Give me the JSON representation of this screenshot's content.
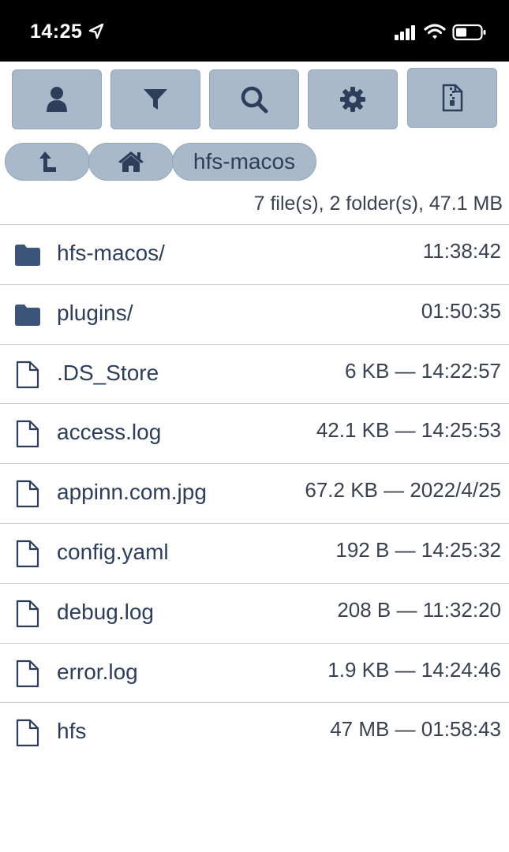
{
  "status_bar": {
    "time": "14:25"
  },
  "toolbar": {
    "buttons": [
      {
        "icon": "user-icon"
      },
      {
        "icon": "filter-icon"
      },
      {
        "icon": "search-icon"
      },
      {
        "icon": "gear-icon"
      },
      {
        "icon": "zip-archive-icon"
      }
    ]
  },
  "breadcrumb": {
    "up_icon": "up-arrow-icon",
    "home_icon": "home-icon",
    "current": "hfs-macos"
  },
  "summary": "7 file(s), 2 folder(s), 47.1 MB",
  "colors": {
    "button_bg": "#a9b9c9",
    "folder_icon": "#3b5478",
    "text": "#2c3e5a"
  },
  "entries": [
    {
      "type": "folder",
      "name": "hfs-macos/",
      "meta": "11:38:42"
    },
    {
      "type": "folder",
      "name": "plugins/",
      "meta": "01:50:35"
    },
    {
      "type": "file",
      "name": ".DS_Store",
      "meta": "6 KB — 14:22:57"
    },
    {
      "type": "file",
      "name": "access.log",
      "meta": "42.1 KB — 14:25:53"
    },
    {
      "type": "file",
      "name": "appinn.com.jpg",
      "meta": "67.2 KB — 2022/4/25"
    },
    {
      "type": "file",
      "name": "config.yaml",
      "meta": "192 B — 14:25:32"
    },
    {
      "type": "file",
      "name": "debug.log",
      "meta": "208 B — 11:32:20"
    },
    {
      "type": "file",
      "name": "error.log",
      "meta": "1.9 KB — 14:24:46"
    },
    {
      "type": "file",
      "name": "hfs",
      "meta": "47 MB — 01:58:43"
    }
  ]
}
